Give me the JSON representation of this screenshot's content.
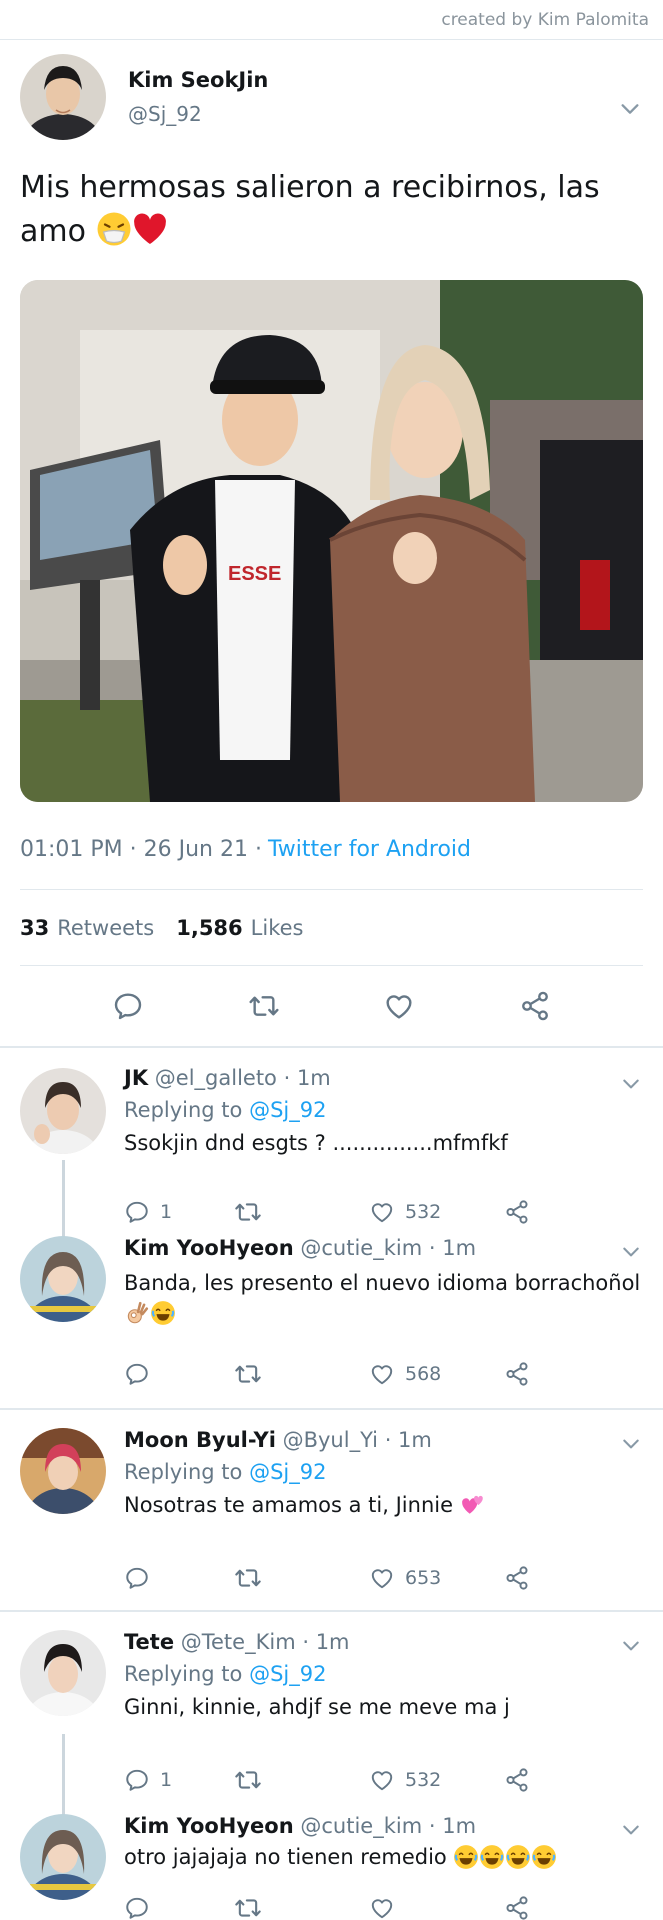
{
  "credit": "created by Kim Palomita",
  "main_tweet": {
    "name": "Kim SeokJin",
    "handle": "@Sj_92",
    "text": "Mis hermosas salieron a recibirnos, las amo",
    "time": "01:01 PM · 26 Jun 21 ·",
    "source": "Twitter for Android",
    "retweets_count": "33",
    "retweets_label": "Retweets",
    "likes_count": "1,586",
    "likes_label": "Likes",
    "shirt_text": "ESSE"
  },
  "replies": [
    {
      "name": "JK",
      "handle": "@el_galleto",
      "time": "· 1m",
      "replying_label": "Replying to",
      "replying_to": "@Sj_92",
      "text": "Ssokjin dnd esgts ? ...............mfmfkf",
      "reply_count": "1",
      "retweet_count": "",
      "like_count": "532"
    },
    {
      "name": "Kim YooHyeon",
      "handle": "@cutie_kim",
      "time": "· 1m",
      "text": "Banda, les presento el nuevo idioma borrachoñol",
      "reply_count": "",
      "retweet_count": "",
      "like_count": "568"
    },
    {
      "name": "Moon Byul-Yi",
      "handle": "@Byul_Yi",
      "time": "· 1m",
      "replying_label": "Replying to",
      "replying_to": "@Sj_92",
      "text": "Nosotras te amamos a ti, Jinnie",
      "reply_count": "",
      "retweet_count": "",
      "like_count": "653"
    },
    {
      "name": "Tete",
      "handle": "@Tete_Kim",
      "time": "· 1m",
      "replying_label": "Replying to",
      "replying_to": "@Sj_92",
      "text": "Ginni, kinnie, ahdjf se me meve ma j",
      "reply_count": "1",
      "retweet_count": "",
      "like_count": "532"
    },
    {
      "name": "Kim YooHyeon",
      "handle": "@cutie_kim",
      "time": "· 1m",
      "text": "otro jajajaja no tienen remedio",
      "reply_count": "",
      "retweet_count": "",
      "like_count": ""
    }
  ],
  "colors": {
    "accent": "#1da1f2",
    "muted": "#657786",
    "text": "#14171a",
    "divider": "#e1e8ed"
  },
  "icons": [
    "chevron-down-icon",
    "reply-icon",
    "retweet-icon",
    "like-icon",
    "share-icon",
    "sneeze-emoji",
    "heart-emoji",
    "ok-hand-emoji",
    "rofl-emoji",
    "two-hearts-emoji"
  ]
}
